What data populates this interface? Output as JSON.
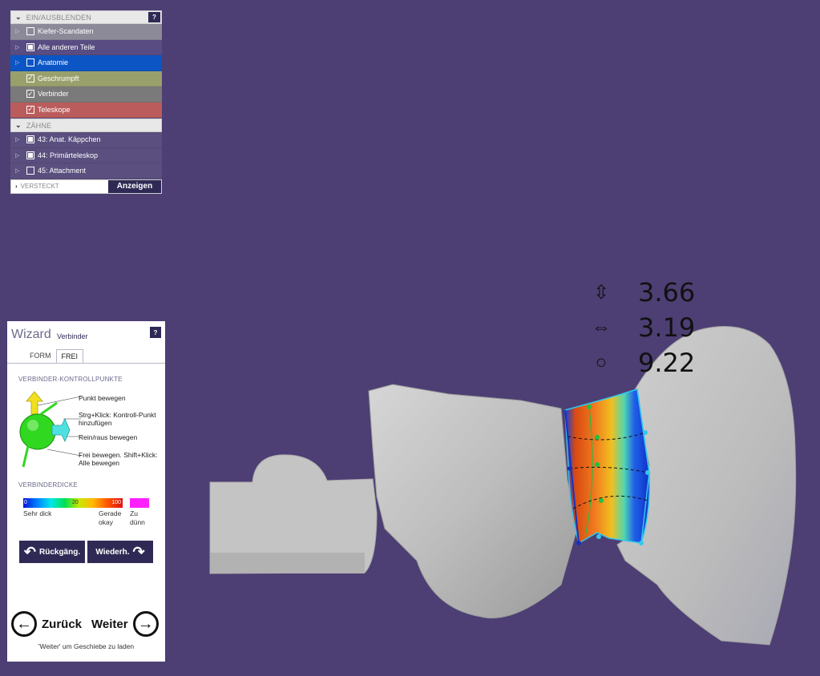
{
  "visibility_panel": {
    "header": "EIN/AUSBLENDEN",
    "help": "?",
    "rows": [
      {
        "label": "Kiefer-Scandaten",
        "checked": false,
        "color": "#8c8a99"
      },
      {
        "label": "Alle anderen Teile",
        "checked": true,
        "color": "#584c82"
      },
      {
        "label": "Anatomie",
        "checked": false,
        "color": "#0c55c4"
      },
      {
        "label": "Geschrumpft",
        "checked": true,
        "color": "#9aa06c"
      },
      {
        "label": "Verbinder",
        "checked": true,
        "color": "#7a7a7a"
      },
      {
        "label": "Teleskope",
        "checked": true,
        "color": "#bb5c5c"
      }
    ],
    "teeth_header": "ZÄHNE",
    "teeth": [
      {
        "label": "43: Anat. Käppchen",
        "checked": true
      },
      {
        "label": "44: Primärteleskop",
        "checked": true
      },
      {
        "label": "45: Attachment",
        "checked": false
      }
    ],
    "hidden_label": "VERSTECKT",
    "show_button": "Anzeigen"
  },
  "wizard": {
    "title": "Wizard",
    "subtitle": "Verbinder",
    "help": "?",
    "tabs": [
      "FORM",
      "FREI"
    ],
    "active_tab": "FREI",
    "control_points_label": "VERBINDER-KONTROLLPUNKTE",
    "control_items": [
      "Punkt bewegen",
      "Strg+Klick: Kontroll-Punkt hinzufügen",
      "Rein/raus bewegen",
      "Frei bewegen. Shift+Klick: Alle bewegen"
    ],
    "thickness_label": "VERBINDERDICKE",
    "scale_numbers": [
      "0",
      "20",
      "100"
    ],
    "scale_labels": {
      "left": "Sehr dick",
      "mid": "Gerade okay",
      "right": "Zu dünn"
    },
    "undo_label": "Rückgäng.",
    "redo_label": "Wiederh.",
    "back_label": "Zurück",
    "next_label": "Weiter",
    "hint": "'Weiter' um Geschiebe zu laden"
  },
  "measurements": [
    {
      "icon": "vertical-arrow-icon",
      "value": "3.66"
    },
    {
      "icon": "horizontal-arrow-icon",
      "value": "3.19"
    },
    {
      "icon": "circle-icon",
      "value": "9.22"
    }
  ],
  "colors": {
    "background": "#4d3f74",
    "panel_dark": "#2f2a55",
    "model": "#c9c9c9"
  }
}
